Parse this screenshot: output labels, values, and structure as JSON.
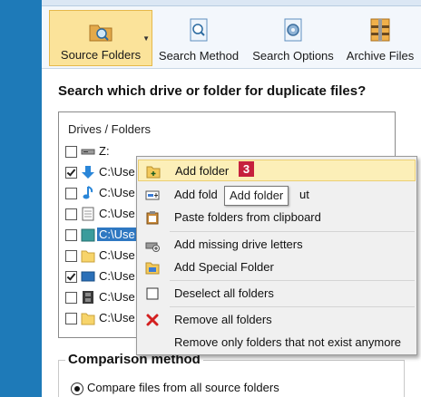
{
  "ribbon": {
    "buttons": [
      {
        "label": "Source Folders",
        "icon": "folder-search-icon",
        "active": true
      },
      {
        "label": "Search Method",
        "icon": "document-search-icon",
        "active": false
      },
      {
        "label": "Search Options",
        "icon": "gear-document-icon",
        "active": false
      },
      {
        "label": "Archive Files",
        "icon": "archive-files-icon",
        "active": false
      }
    ]
  },
  "main": {
    "heading": "Search which drive or folder for duplicate files?",
    "list": {
      "column_header": "Drives / Folders",
      "rows": [
        {
          "text": "Z:",
          "checked": false,
          "icon": "drive-icon"
        },
        {
          "text": "C:\\Use",
          "checked": true,
          "icon": "download-arrow-icon"
        },
        {
          "text": "C:\\Use",
          "checked": false,
          "icon": "music-note-icon"
        },
        {
          "text": "C:\\Use",
          "checked": false,
          "icon": "document-icon"
        },
        {
          "text": "C:\\Use",
          "checked": false,
          "icon": "teal-folder-icon",
          "selected": true
        },
        {
          "text": "C:\\Use",
          "checked": false,
          "icon": "yellow-folder-icon"
        },
        {
          "text": "C:\\Use",
          "checked": true,
          "icon": "monitor-icon"
        },
        {
          "text": "C:\\Use",
          "checked": false,
          "icon": "film-strip-icon"
        },
        {
          "text": "C:\\Use",
          "checked": false,
          "icon": "yellow-folder-icon"
        }
      ]
    },
    "comparison": {
      "title": "Comparison method",
      "option_label": "Compare files from all source folders"
    }
  },
  "context_menu": {
    "items": [
      {
        "label": "Add folder",
        "icon": "add-folder-icon",
        "highlighted": true
      },
      {
        "label": "Add folders with input",
        "visible_label": "Add fold",
        "trailing": "ut",
        "icon": "add-folder-input-icon"
      },
      {
        "label": "Paste folders from clipboard",
        "icon": "clipboard-icon"
      },
      {
        "label": "Add missing drive letters",
        "icon": "drive-add-icon"
      },
      {
        "label": "Add Special Folder",
        "icon": "special-folder-icon"
      },
      {
        "label": "Deselect all folders",
        "icon": "checkbox-icon"
      },
      {
        "label": "Remove all folders",
        "icon": "red-x-icon"
      },
      {
        "label": "Remove only folders that not exist anymore",
        "icon": ""
      }
    ],
    "badge": "3",
    "tooltip": "Add folder"
  },
  "colors": {
    "accent_blue": "#1e7ab8",
    "selection": "#2f78c2",
    "ribbon_active": "#fbe39a",
    "menu_highlight": "#fcefb8",
    "badge_red": "#c6203c"
  }
}
